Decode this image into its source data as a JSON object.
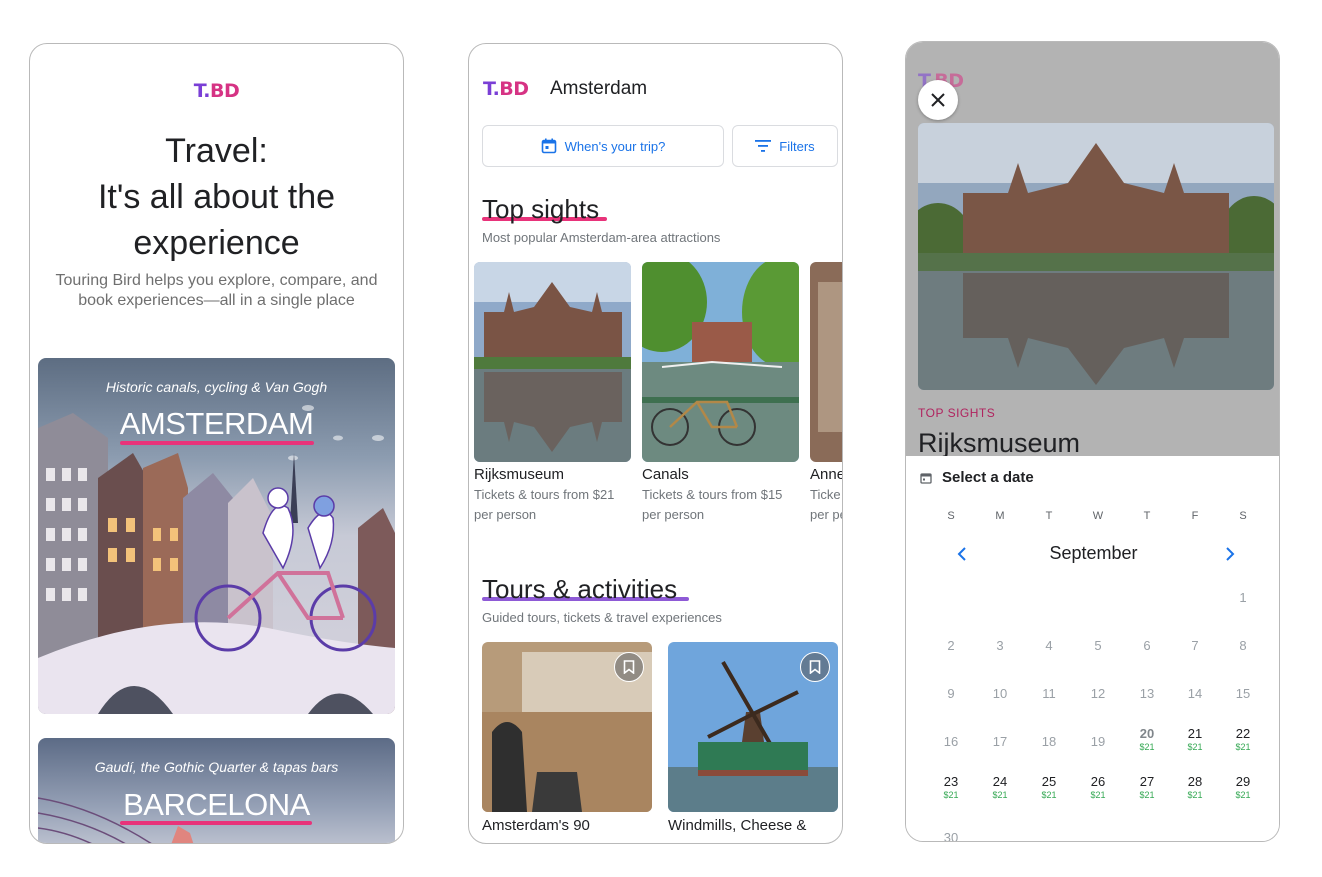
{
  "screen1": {
    "logo": {
      "left": "T.",
      "right": "BD"
    },
    "title": [
      "Travel:",
      "It's all about the",
      "experience"
    ],
    "subtitle": "Touring Bird helps you explore, compare, and book experiences—all in a single place",
    "cities": [
      {
        "tagline": "Historic canals, cycling & Van Gogh",
        "name": "AMSTERDAM"
      },
      {
        "tagline": "Gaudí, the Gothic Quarter & tapas bars",
        "name": "BARCELONA"
      }
    ]
  },
  "screen2": {
    "logo": {
      "left": "T.",
      "right": "BD"
    },
    "city": "Amsterdam",
    "trip_button": "When's your trip?",
    "filters_button": "Filters",
    "top_sights": {
      "title": "Top sights",
      "subtitle": "Most popular Amsterdam-area attractions",
      "items": [
        {
          "name": "Rijksmuseum",
          "price_line1": "Tickets & tours from $21",
          "price_line2": "per person"
        },
        {
          "name": "Canals",
          "price_line1": "Tickets & tours from $15",
          "price_line2": "per person"
        },
        {
          "name": "Anne",
          "price_line1": "Ticke",
          "price_line2": "per pe"
        }
      ]
    },
    "tours": {
      "title": "Tours & activities",
      "subtitle": "Guided tours, tickets & travel experiences",
      "items": [
        {
          "name": "Amsterdam's 90"
        },
        {
          "name": "Windmills, Cheese &"
        }
      ]
    },
    "colors": {
      "underline_sights": "#e8337a",
      "underline_tours": "#8e5ad6",
      "accent": "#1a73e8"
    }
  },
  "screen3": {
    "logo": {
      "left": "T.",
      "right": "BD"
    },
    "category": "TOP SIGHTS",
    "title": "Rijksmuseum",
    "select_date": "Select a date",
    "weekdays": [
      "S",
      "M",
      "T",
      "W",
      "T",
      "F",
      "S"
    ],
    "month": "September",
    "days": [
      {
        "d": "1"
      },
      {
        "d": "2"
      },
      {
        "d": "3"
      },
      {
        "d": "4"
      },
      {
        "d": "5"
      },
      {
        "d": "6"
      },
      {
        "d": "7"
      },
      {
        "d": "8"
      },
      {
        "d": "9"
      },
      {
        "d": "10"
      },
      {
        "d": "11"
      },
      {
        "d": "12"
      },
      {
        "d": "13"
      },
      {
        "d": "14"
      },
      {
        "d": "15"
      },
      {
        "d": "16"
      },
      {
        "d": "17"
      },
      {
        "d": "18"
      },
      {
        "d": "19"
      },
      {
        "d": "20",
        "p": "$21",
        "today": true
      },
      {
        "d": "21",
        "p": "$21"
      },
      {
        "d": "22",
        "p": "$21"
      },
      {
        "d": "23",
        "p": "$21"
      },
      {
        "d": "24",
        "p": "$21"
      },
      {
        "d": "25",
        "p": "$21"
      },
      {
        "d": "26",
        "p": "$21"
      },
      {
        "d": "27",
        "p": "$21"
      },
      {
        "d": "28",
        "p": "$21"
      },
      {
        "d": "29",
        "p": "$21"
      },
      {
        "d": "30"
      }
    ]
  }
}
